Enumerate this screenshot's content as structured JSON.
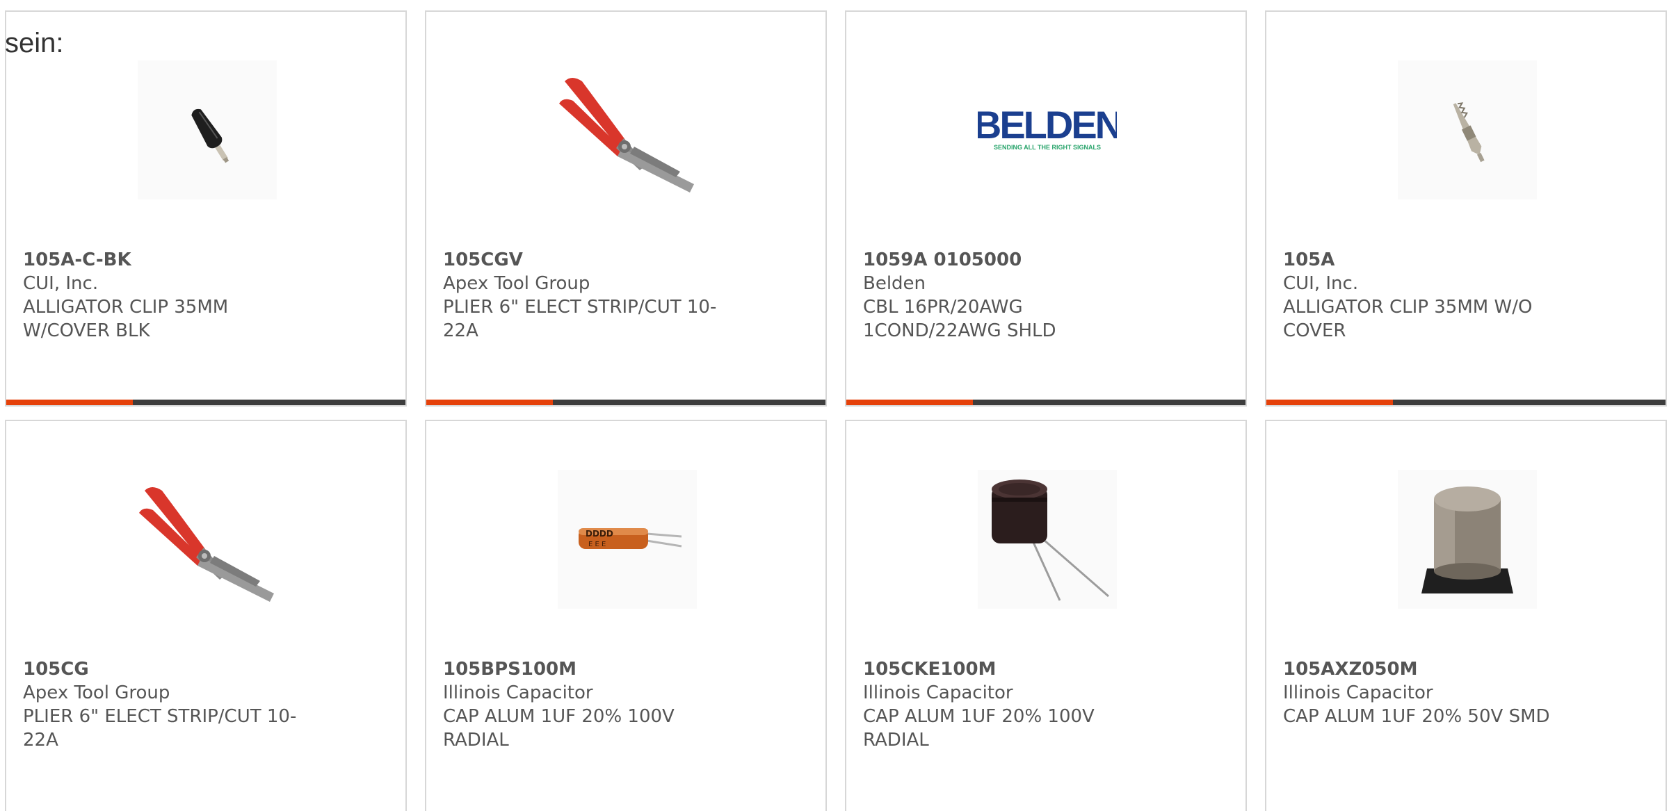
{
  "heading": "sein:",
  "colors": {
    "accent": "#e5410a",
    "bar_dark": "#3d3d3d",
    "border": "#d7d7d7",
    "text": "#555555"
  },
  "products": [
    {
      "part_number": "105A-C-BK",
      "manufacturer": "CUI, Inc.",
      "description": "ALLIGATOR CLIP 35MM W/COVER BLK",
      "image": "alligator-clip-black-icon"
    },
    {
      "part_number": "105CGV",
      "manufacturer": "Apex Tool Group",
      "description": "PLIER 6\" ELECT STRIP/CUT 10-22A",
      "image": "wire-stripper-plier-icon"
    },
    {
      "part_number": "1059A 0105000",
      "manufacturer": "Belden",
      "description": "CBL 16PR/20AWG 1COND/22AWG SHLD",
      "image": "belden-logo",
      "logo_text": "BELDEN",
      "logo_tagline": "SENDING ALL THE RIGHT SIGNALS"
    },
    {
      "part_number": "105A",
      "manufacturer": "CUI, Inc.",
      "description": "ALLIGATOR CLIP 35MM W/O COVER",
      "image": "alligator-clip-metal-icon"
    },
    {
      "part_number": "105CG",
      "manufacturer": "Apex Tool Group",
      "description": "PLIER 6\" ELECT STRIP/CUT 10-22A",
      "image": "wire-stripper-plier-icon"
    },
    {
      "part_number": "105BPS100M",
      "manufacturer": "Illinois Capacitor",
      "description": "CAP ALUM 1UF 20% 100V RADIAL",
      "image": "axial-capacitor-orange-icon"
    },
    {
      "part_number": "105CKE100M",
      "manufacturer": "Illinois Capacitor",
      "description": "CAP ALUM 1UF 20% 100V RADIAL",
      "image": "radial-capacitor-black-icon"
    },
    {
      "part_number": "105AXZ050M",
      "manufacturer": "Illinois Capacitor",
      "description": "CAP ALUM 1UF 20% 50V SMD",
      "image": "smd-capacitor-icon"
    }
  ]
}
